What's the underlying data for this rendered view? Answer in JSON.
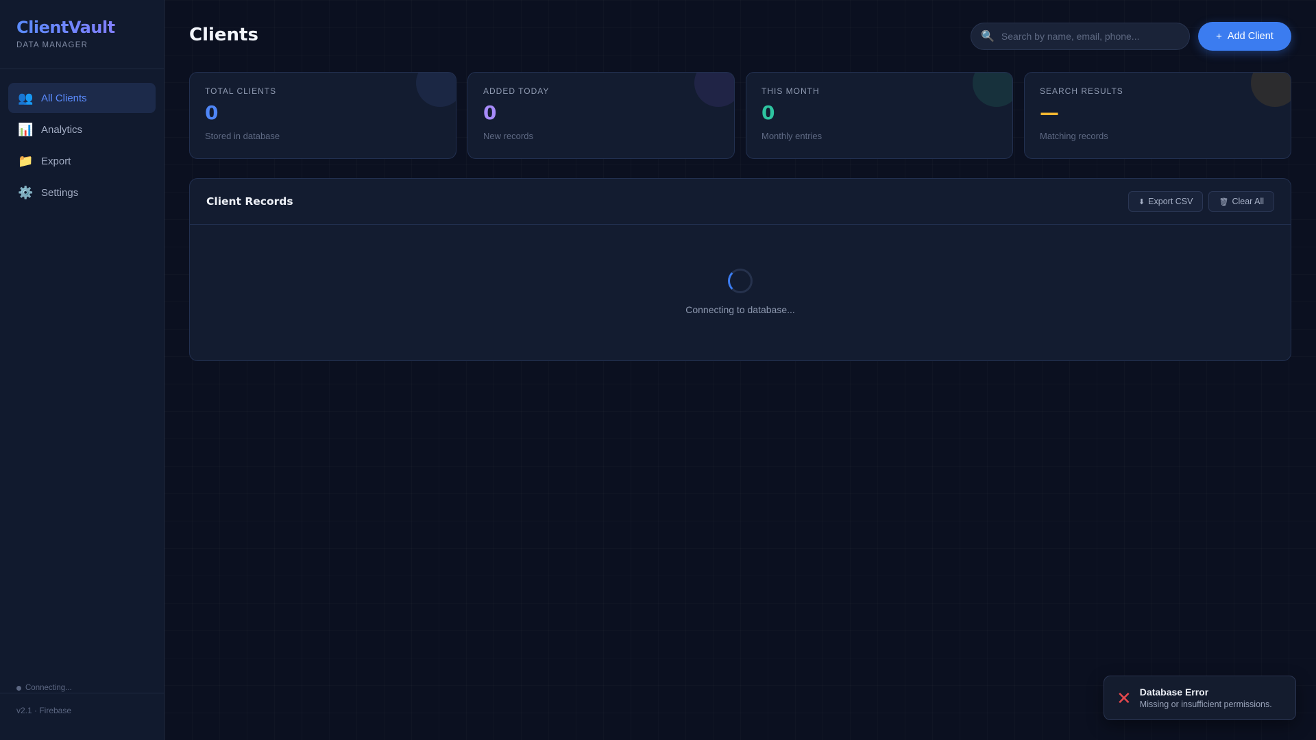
{
  "brand": {
    "title": "ClientVault",
    "subtitle": "DATA MANAGER"
  },
  "sidebar": {
    "items": [
      {
        "label": "All Clients",
        "icon": "👥",
        "icon_name": "users-icon",
        "active": true
      },
      {
        "label": "Analytics",
        "icon": "📊",
        "icon_name": "chart-icon",
        "active": false
      },
      {
        "label": "Export",
        "icon": "📁",
        "icon_name": "folder-icon",
        "active": false
      },
      {
        "label": "Settings",
        "icon": "⚙️",
        "icon_name": "gear-icon",
        "active": false
      }
    ],
    "status": "Connecting...",
    "version": "v2.1 · Firebase"
  },
  "header": {
    "title": "Clients",
    "search_placeholder": "Search by name, email, phone...",
    "add_button": "Add Client",
    "add_icon": "+"
  },
  "stats": [
    {
      "label": "TOTAL CLIENTS",
      "value": "0",
      "sub": "Stored in database",
      "color": "#4f86f7",
      "blob": "#2c3d6b"
    },
    {
      "label": "ADDED TODAY",
      "value": "0",
      "sub": "New records",
      "color": "#a78bfa",
      "blob": "#3a3470"
    },
    {
      "label": "THIS MONTH",
      "value": "0",
      "sub": "Monthly entries",
      "color": "#2ec4a0",
      "blob": "#1f5a52"
    },
    {
      "label": "SEARCH RESULTS",
      "value": "—",
      "sub": "Matching records",
      "color": "#f5b731",
      "blob": "#5b4a2a"
    }
  ],
  "records": {
    "title": "Client Records",
    "export_button": "Export CSV",
    "export_icon": "⬇",
    "clear_button": "Clear All",
    "clear_icon": "🗑",
    "loading_text": "Connecting to database..."
  },
  "toast": {
    "icon": "✕",
    "title": "Database Error",
    "message": "Missing or insufficient permissions."
  }
}
